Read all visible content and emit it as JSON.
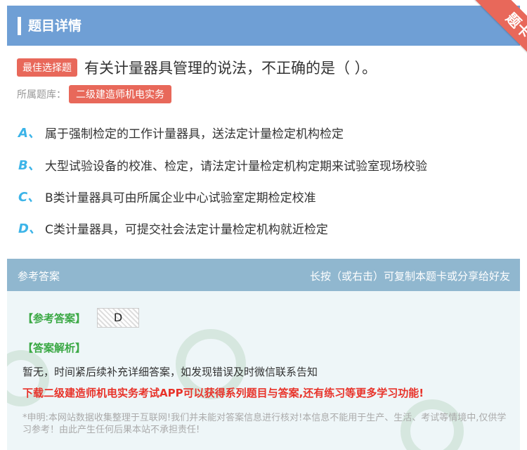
{
  "header": {
    "title": "题目详情",
    "ribbon": "题卡"
  },
  "question": {
    "badge": "最佳选择题",
    "text": "有关计量器具管理的说法，不正确的是（   ）。",
    "bank_label": "所属题库：",
    "bank": "二级建造师机电实务"
  },
  "options": [
    {
      "letter": "A、",
      "text": "属于强制检定的工作计量器具，送法定计量检定机构检定"
    },
    {
      "letter": "B、",
      "text": "大型试验设备的校准、检定，请法定计量检定机构定期来试验室现场校验"
    },
    {
      "letter": "C、",
      "text": "B类计量器具可由所属企业中心试验室定期检定校准"
    },
    {
      "letter": "D、",
      "text": "C类计量器具，可提交社会法定计量检定机构就近检定"
    }
  ],
  "answer": {
    "head_left": "参考答案",
    "head_right": "长按（或右击）可复制本题卡或分享给好友",
    "answer_label": "【参考答案】",
    "answer_value": "D",
    "analysis_label": "【答案解析】",
    "analysis_text": "暂无，时间紧后续补充详细答案，如发现错误及时微信联系告知",
    "promo": "下载二级建造师机电实务考试APP可以获得系列题目与答案,还有练习等更多学习功能!",
    "disclaimer": "*申明:本网站数据收集整理于互联网!我们并未能对答案信息进行核对!本信息不能用于生产、生活、考试等情境中,仅供学习参考！由此产生任何后果本站不承担责任!"
  },
  "colors": {
    "header": "#6f9fd5",
    "accent": "#e8685a",
    "option_letter": "#3cb4e8",
    "answer_green": "#3aa844",
    "promo_red": "#e8332a"
  }
}
